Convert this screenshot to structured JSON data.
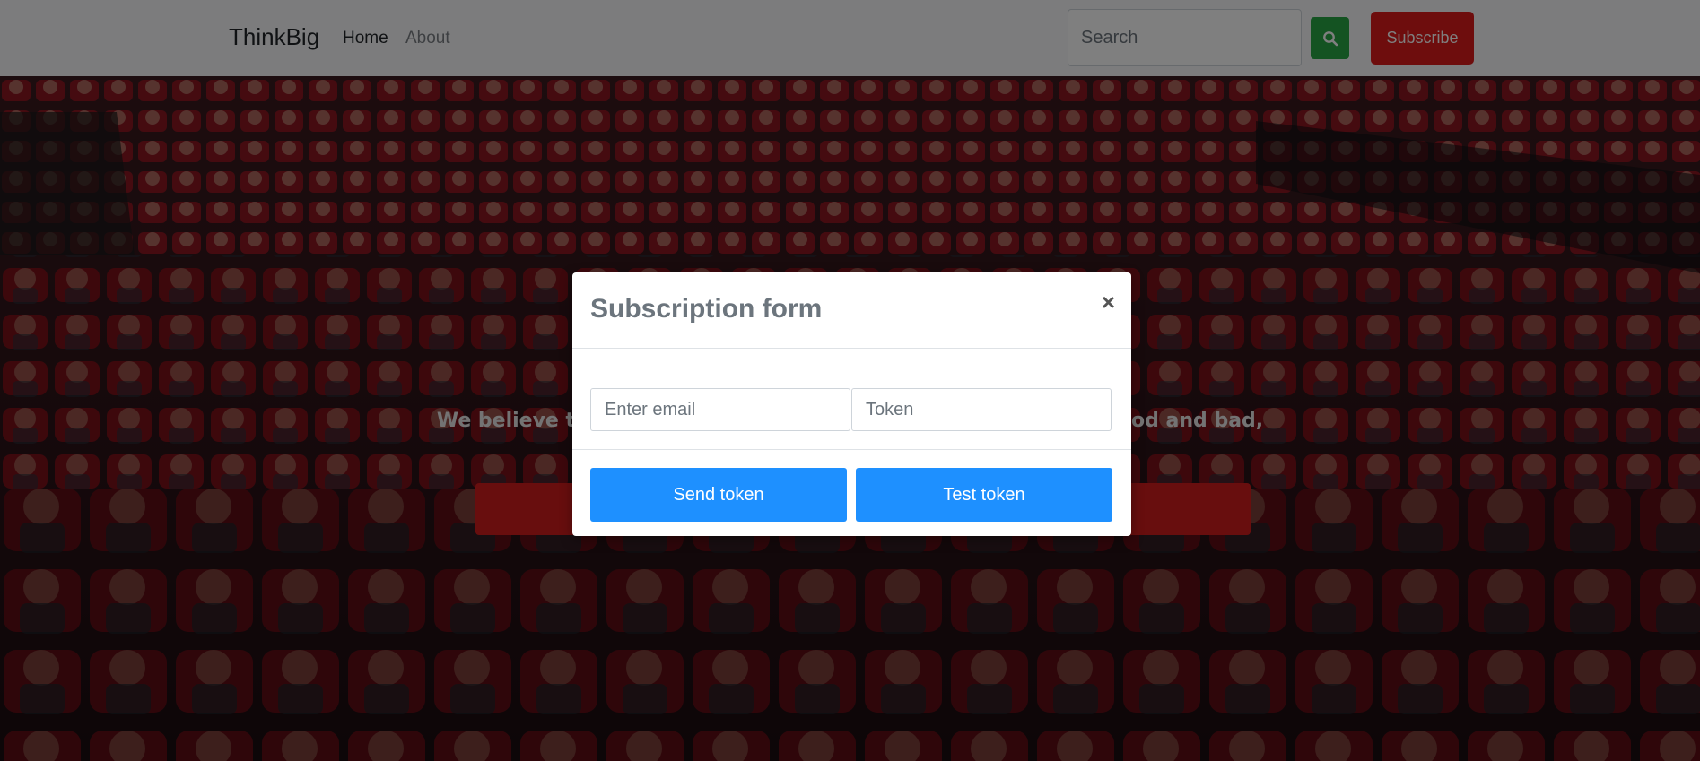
{
  "navbar": {
    "brand": "ThinkBig",
    "links": [
      {
        "label": "Home"
      },
      {
        "label": "About"
      }
    ],
    "search": {
      "placeholder": "Search",
      "value": ""
    },
    "subscribe_label": "Subscribe"
  },
  "hero": {
    "tagline_left": "We believe t",
    "tagline_right": "od and bad,",
    "button_label": ""
  },
  "modal": {
    "title": "Subscription form",
    "close_label": "×",
    "email_field": {
      "placeholder": "Enter email",
      "value": ""
    },
    "token_field": {
      "placeholder": "Token",
      "value": ""
    },
    "send_token_label": "Send token",
    "test_token_label": "Test token"
  },
  "colors": {
    "subscribe": "#dc1a1a",
    "search_button": "#28a745",
    "modal_buttons": "#1e90ff",
    "hero_button": "#d01c1c"
  },
  "icons": {
    "search": "search-icon",
    "close": "close-icon"
  }
}
